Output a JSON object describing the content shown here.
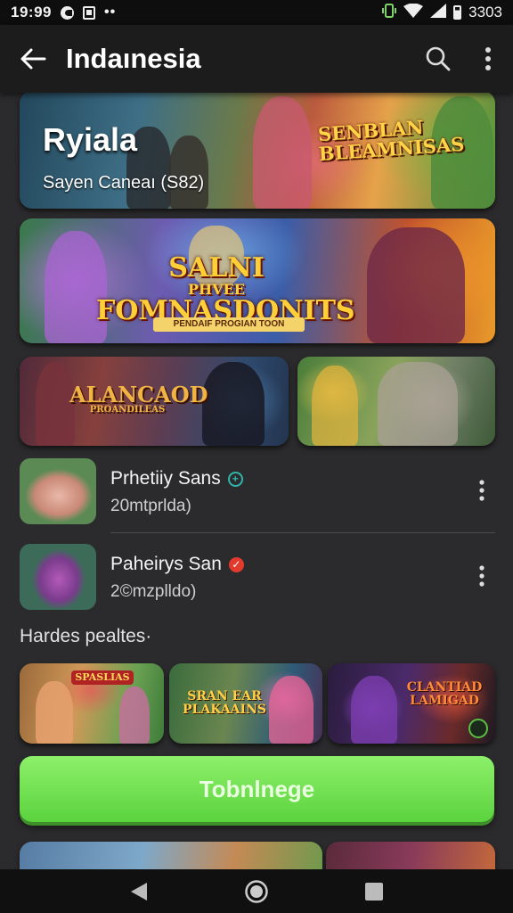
{
  "status_bar": {
    "time": "19:99",
    "battery_text": "3303"
  },
  "app_bar": {
    "title": "Indaınesia"
  },
  "banners": [
    {
      "title": "Ryiala",
      "subtitle": "Sayen Caneaı (S82)",
      "logo": "SENBLAN BLEAMNISAS"
    },
    {
      "logo_line1": "SALNI",
      "logo_line2": "PHVEE",
      "logo_line3": "FOMNASDONITS",
      "logo_sub": "PENDAIF PROGIAN TOON"
    }
  ],
  "tiles": [
    {
      "logo_line1": "ALANCAOD",
      "logo_line2": "PROANDILEAS"
    }
  ],
  "list": [
    {
      "name": "Prhetiiy Sans",
      "badge": "+",
      "sub": "20mtprlda)"
    },
    {
      "name": "Paheirys San",
      "badge": "✓",
      "sub": "2©mzplldo)"
    }
  ],
  "section": {
    "title": "Hardes pealtes·"
  },
  "small_tiles": [
    {
      "logo": "SPASLIAS"
    },
    {
      "logo_line1": "SRAN EAR",
      "logo_line2": "PLAKAAINS"
    },
    {
      "logo_line1": "CLANTIAD",
      "logo_line2": "LAMIGAD"
    }
  ],
  "cta": {
    "label": "Tobnlnege"
  },
  "colors": {
    "accent_green": "#6be24a",
    "background": "#2b2b2d",
    "app_bar": "#1c1c1d"
  },
  "icons": [
    "arrow-back-icon",
    "search-icon",
    "more-vert-icon",
    "nav-back-icon",
    "nav-home-icon",
    "nav-recents-icon"
  ]
}
